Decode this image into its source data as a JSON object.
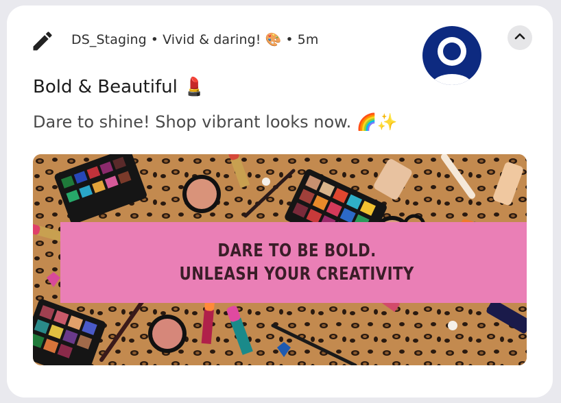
{
  "notification": {
    "app_name": "DS_Staging",
    "separator": "•",
    "subtext": "Vivid & daring! 🎨",
    "time": "5m",
    "title": "Bold & Beautiful 💄",
    "body": "Dare to shine! Shop vibrant looks now. 🌈✨",
    "icons": {
      "app_icon": "pencil-icon",
      "avatar": "user-avatar-icon",
      "collapse": "chevron-up-icon"
    },
    "banner": {
      "line1": "DARE TO BE BOLD.",
      "line2": "UNLEASH YOUR CREATIVITY",
      "colors": {
        "strip": "#ea7fb6",
        "background": "#b67a3f",
        "avatar": "#0d2a80"
      }
    }
  }
}
